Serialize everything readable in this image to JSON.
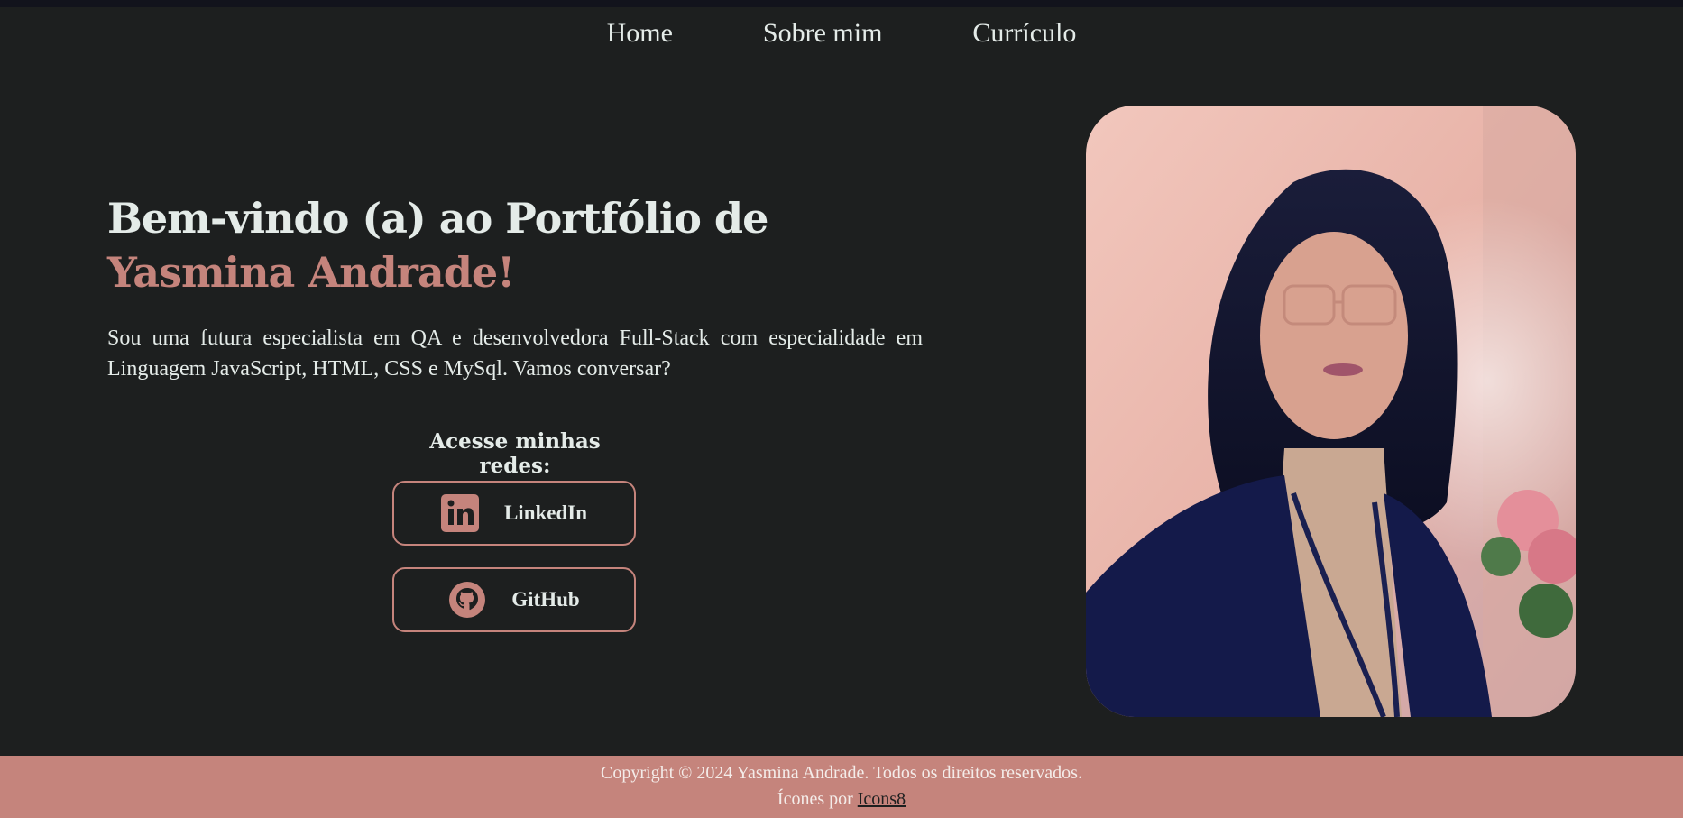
{
  "nav": {
    "items": [
      {
        "label": "Home"
      },
      {
        "label": "Sobre mim"
      },
      {
        "label": "Currículo"
      }
    ]
  },
  "hero": {
    "title_prefix": "Bem-vindo (a) ao Portfólio de ",
    "title_name": "Yasmina Andrade!",
    "intro": "Sou uma futura especialista em QA e desenvolvedora Full-Stack com especialidade em Linguagem JavaScript, HTML, CSS e MySql. Vamos conversar?"
  },
  "social": {
    "heading": "Acesse minhas redes:",
    "linkedin_label": "LinkedIn",
    "github_label": "GitHub"
  },
  "footer": {
    "copyright": "Copyright © 2024 Yasmina Andrade. Todos os direitos reservados.",
    "icons_prefix": "Ícones por ",
    "icons_link": "Icons8"
  },
  "colors": {
    "background": "#1d1f1f",
    "accent": "#c5847c",
    "text": "#e4ebe8"
  },
  "icons": [
    "linkedin-icon",
    "github-icon"
  ]
}
